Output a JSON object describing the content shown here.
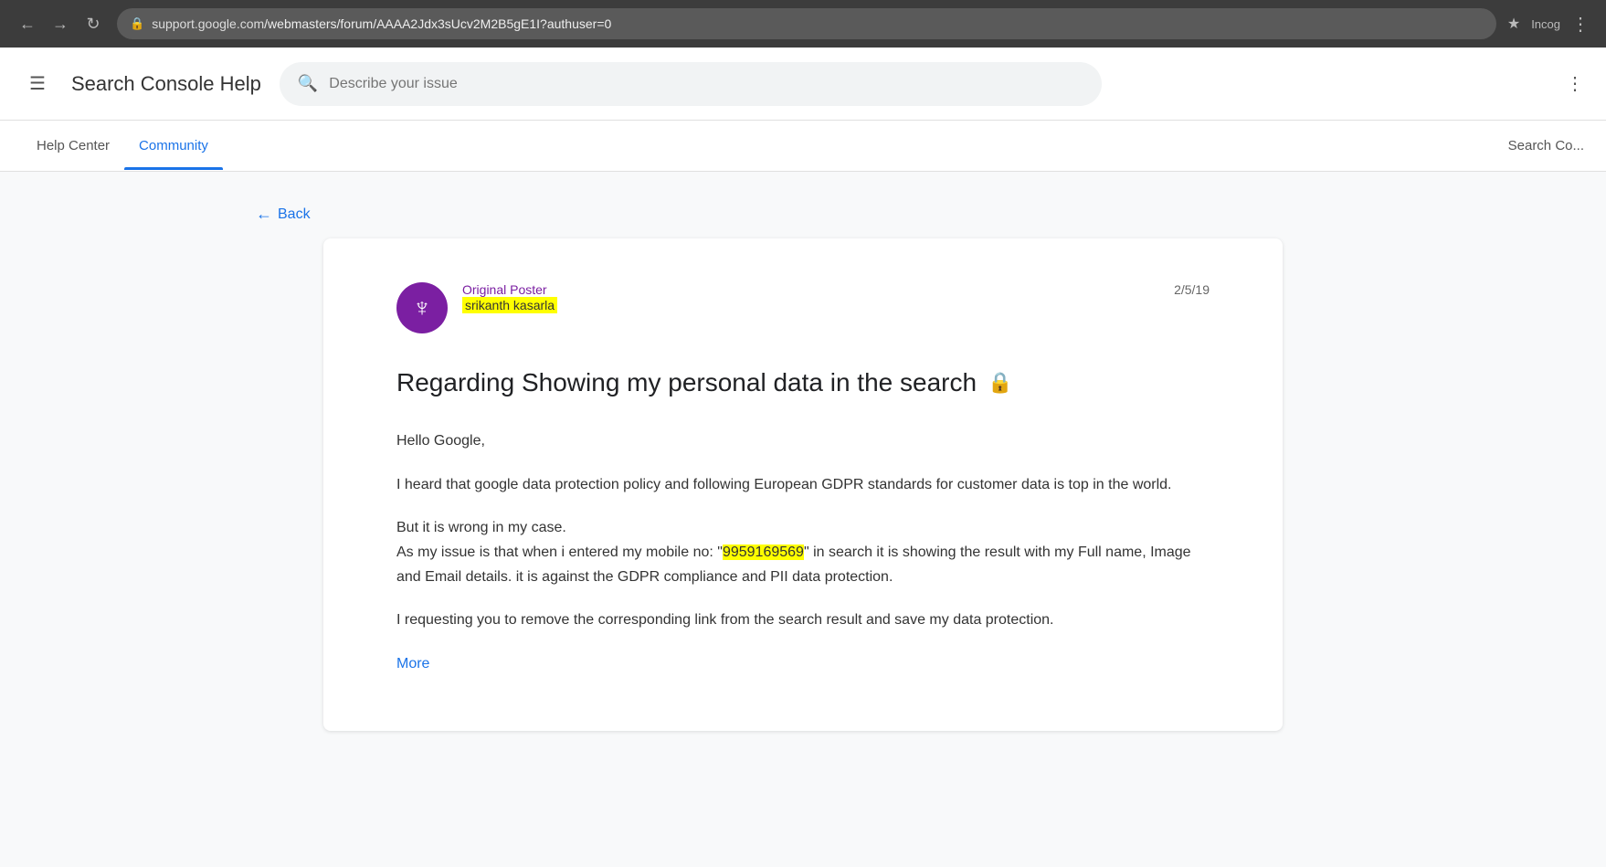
{
  "browser": {
    "url_prefix": "support.google.com",
    "url_path": "/webmasters/forum/AAAA2Jdx3sUcv2M2B5gE1I?authuser=0",
    "incog_label": "Incog"
  },
  "header": {
    "menu_icon": "☰",
    "title": "Search Console Help",
    "search_placeholder": "Describe your issue",
    "more_icon": "⋮"
  },
  "nav": {
    "tab_help_center": "Help Center",
    "tab_community": "Community",
    "tab_right": "Search Co..."
  },
  "back": {
    "label": "Back"
  },
  "post": {
    "poster_label": "Original Poster",
    "poster_name": "srikanth kasarla",
    "date": "2/5/19",
    "title": "Regarding Showing my personal data in the search",
    "greeting": "Hello Google,",
    "body1": "I heard that google data protection policy and following European GDPR standards for customer data is top in the world.",
    "body2": "But it is wrong in my case.",
    "body3_before": "As my issue is that when i entered my mobile no: \"",
    "phone_number": "9959169569",
    "body3_after": "\" in search it is showing the result with my Full name, Image and Email details. it is against the GDPR compliance and PII data protection.",
    "body4": "I requesting you to remove the corresponding link from the search result and save my data protection.",
    "more_label": "More"
  }
}
